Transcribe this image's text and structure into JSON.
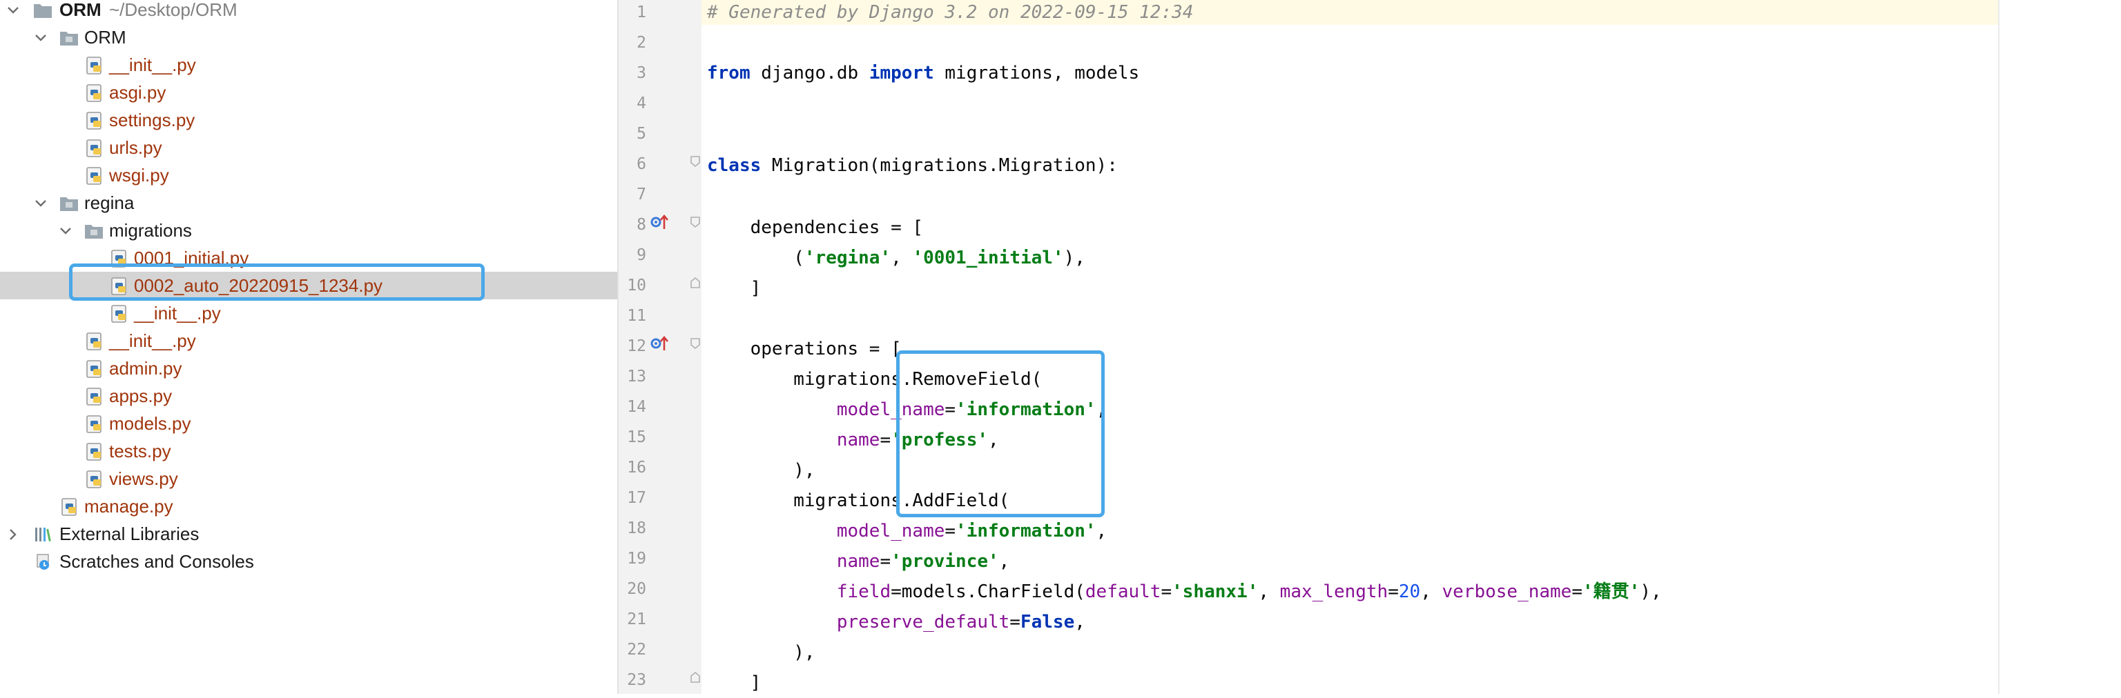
{
  "project_tree": {
    "root": {
      "name": "ORM",
      "path": "~/Desktop/ORM"
    },
    "items": [
      {
        "label": "ORM",
        "type": "folder"
      },
      {
        "label": "__init__.py",
        "type": "py"
      },
      {
        "label": "asgi.py",
        "type": "py"
      },
      {
        "label": "settings.py",
        "type": "py"
      },
      {
        "label": "urls.py",
        "type": "py"
      },
      {
        "label": "wsgi.py",
        "type": "py"
      },
      {
        "label": "regina",
        "type": "folder"
      },
      {
        "label": "migrations",
        "type": "folder"
      },
      {
        "label": "0001_initial.py",
        "type": "py"
      },
      {
        "label": "0002_auto_20220915_1234.py",
        "type": "py",
        "selected": true
      },
      {
        "label": "__init__.py",
        "type": "py"
      },
      {
        "label": "__init__.py",
        "type": "py"
      },
      {
        "label": "admin.py",
        "type": "py"
      },
      {
        "label": "apps.py",
        "type": "py"
      },
      {
        "label": "models.py",
        "type": "py"
      },
      {
        "label": "tests.py",
        "type": "py"
      },
      {
        "label": "views.py",
        "type": "py"
      },
      {
        "label": "manage.py",
        "type": "py"
      },
      {
        "label": "External Libraries",
        "type": "libraries"
      },
      {
        "label": "Scratches and Consoles",
        "type": "scratches"
      }
    ]
  },
  "editor": {
    "line_numbers": [
      "1",
      "2",
      "3",
      "4",
      "5",
      "6",
      "7",
      "8",
      "9",
      "10",
      "11",
      "12",
      "13",
      "14",
      "15",
      "16",
      "17",
      "18",
      "19",
      "20",
      "21",
      "22",
      "23"
    ],
    "code": {
      "l1": "# Generated by Django 3.2 on 2022-09-15 12:34",
      "l3_from": "from",
      "l3_mod": " django.db ",
      "l3_import": "import",
      "l3_rest": " migrations, models",
      "l6_class": "class",
      "l6_rest": " Migration(migrations.Migration):",
      "l8": "    dependencies = [",
      "l9_a": "        (",
      "l9_s1": "'regina'",
      "l9_b": ", ",
      "l9_s2": "'0001_initial'",
      "l9_c": "),",
      "l10": "    ]",
      "l12": "    operations = [",
      "l13": "        migrations.RemoveField(",
      "l14_ind": "            ",
      "l14_kw": "model_name",
      "l14_eq": "=",
      "l14_s": "'information'",
      "l14_c": ",",
      "l15_ind": "            ",
      "l15_kw": "name",
      "l15_eq": "=",
      "l15_s": "'profess'",
      "l15_c": ",",
      "l16": "        ),",
      "l17": "        migrations.AddField(",
      "l18_ind": "            ",
      "l18_kw": "model_name",
      "l18_eq": "=",
      "l18_s": "'information'",
      "l18_c": ",",
      "l19_ind": "            ",
      "l19_kw": "name",
      "l19_eq": "=",
      "l19_s": "'province'",
      "l19_c": ",",
      "l20_ind": "            ",
      "l20_kw1": "field",
      "l20_a": "=models.CharField(",
      "l20_kw2": "default",
      "l20_eq2": "=",
      "l20_s1": "'shanxi'",
      "l20_b": ", ",
      "l20_kw3": "max_length",
      "l20_eq3": "=",
      "l20_n": "20",
      "l20_c": ", ",
      "l20_kw4": "verbose_name",
      "l20_eq4": "=",
      "l20_s2": "'籍贯'",
      "l20_d": "),",
      "l21_ind": "            ",
      "l21_kw": "preserve_default",
      "l21_eq": "=",
      "l21_false": "False",
      "l21_c": ",",
      "l22": "        ),",
      "l23": "    ]"
    }
  },
  "colors": {
    "highlight_box": "#4aa8e8",
    "selected_row": "#d4d4d4",
    "current_line": "#fffae3",
    "keyword": "#0033b3",
    "string": "#067d17",
    "comment": "#8c8c8c",
    "named_arg": "#871094",
    "number": "#1750eb",
    "py_file": "#a0350c"
  }
}
